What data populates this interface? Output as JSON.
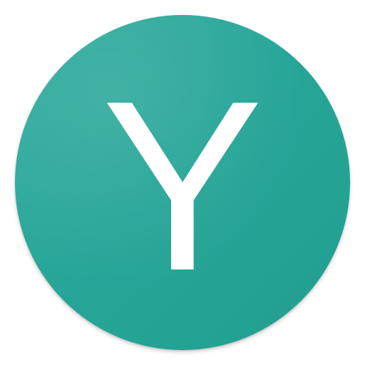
{
  "avatar": {
    "initial": "Y",
    "background_color": "#26a69a",
    "text_color": "#ffffff"
  }
}
